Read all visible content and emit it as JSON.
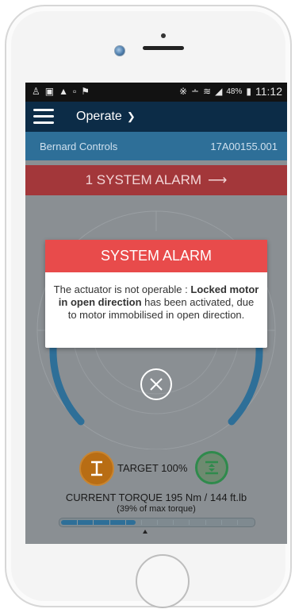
{
  "status_bar": {
    "battery_percent": "48%",
    "time": "11:12"
  },
  "app_bar": {
    "menu_label": "Operate"
  },
  "info_bar": {
    "company": "Bernard Controls",
    "serial": "17A00155.001"
  },
  "alarm_bar": {
    "text": "1 SYSTEM ALARM"
  },
  "modal": {
    "title": "SYSTEM ALARM",
    "message_prefix": "The actuator is not operable : ",
    "message_bold": "Locked motor in open direction",
    "message_suffix": " has been activated, due to motor immobilised in open direction."
  },
  "controls": {
    "target_label": "TARGET 100%",
    "torque_line": "CURRENT TORQUE 195 Nm / 144 ft.lb",
    "torque_sub": "(39% of max torque)",
    "torque_fraction": 0.39
  },
  "colors": {
    "app_bar": "#0c2c47",
    "info_bar": "#2e6f98",
    "alarm_bar": "#a3373a",
    "modal_header": "#e84b4b",
    "dial_arc": "#2e6f98",
    "target_button": "#b86d14",
    "limit_button": "#2f8a4c"
  },
  "icons": {
    "status_left": [
      "person-icon",
      "image-icon",
      "warning-icon",
      "gallery-icon",
      "flag-icon"
    ],
    "status_right": [
      "bluetooth-icon",
      "mute-icon",
      "wifi-icon",
      "signal-icon",
      "battery-icon"
    ]
  }
}
